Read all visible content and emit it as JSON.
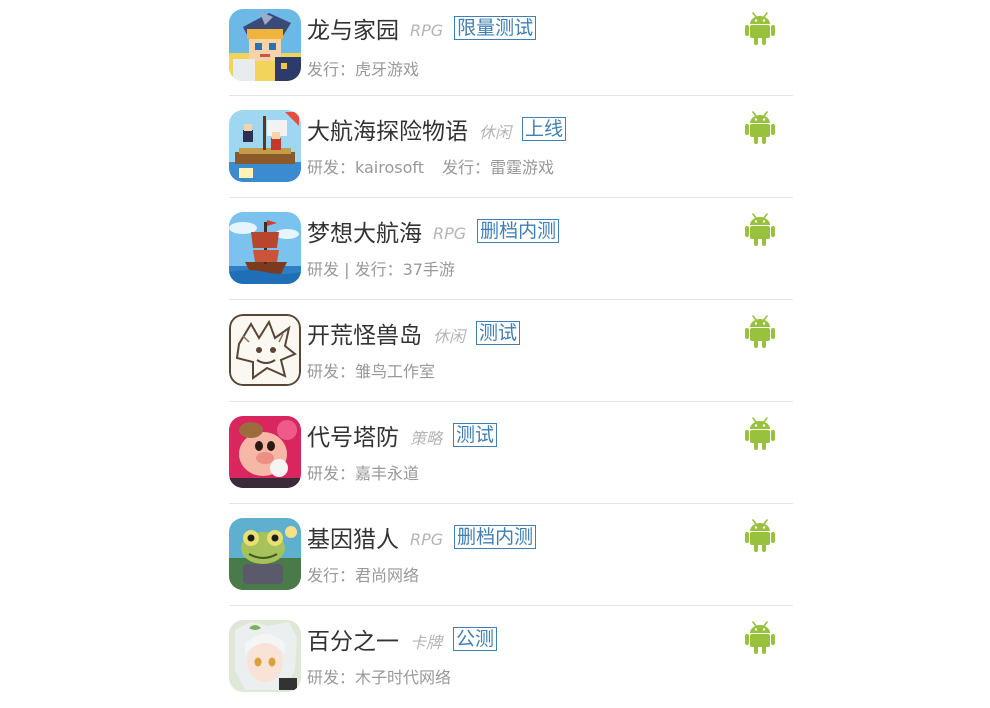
{
  "colors": {
    "android_green": "#98c13d",
    "tag_blue": "#3f7fb5",
    "title_text": "#333333",
    "meta_text": "#999999",
    "genre_text": "#b5b5b5",
    "divider": "#e5e5e5"
  },
  "games": [
    {
      "name": "龙与家园",
      "genre": "RPG",
      "status": "限量测试",
      "credits": [
        {
          "text": "发行：虎牙游戏"
        }
      ],
      "icon": "dragon-homeland-icon",
      "platform_icon": "android-icon"
    },
    {
      "name": "大航海探险物语",
      "genre": "休闲",
      "status": "上线",
      "credits": [
        {
          "text": "研发：kairosoft"
        },
        {
          "text": "发行：雷霆游戏"
        }
      ],
      "icon": "pirate-ship-pixel-icon",
      "platform_icon": "android-icon"
    },
    {
      "name": "梦想大航海",
      "genre": "RPG",
      "status": "删档内测",
      "credits": [
        {
          "text": "研发 | 发行：37手游"
        }
      ],
      "icon": "sailing-ship-icon",
      "platform_icon": "android-icon"
    },
    {
      "name": "开荒怪兽岛",
      "genre": "休闲",
      "status": "测试",
      "credits": [
        {
          "text": "研发：雏鸟工作室"
        }
      ],
      "icon": "monster-sketch-icon",
      "platform_icon": "android-icon"
    },
    {
      "name": "代号塔防",
      "genre": "策略",
      "status": "测试",
      "credits": [
        {
          "text": "研发：嘉丰永道"
        }
      ],
      "icon": "pig-character-icon",
      "platform_icon": "android-icon"
    },
    {
      "name": "基因猎人",
      "genre": "RPG",
      "status": "删档内测",
      "credits": [
        {
          "text": "发行：君尚网络"
        }
      ],
      "icon": "frog-warrior-icon",
      "platform_icon": "android-icon"
    },
    {
      "name": "百分之一",
      "genre": "卡牌",
      "status": "公测",
      "credits": [
        {
          "text": "研发：木子时代网络"
        }
      ],
      "icon": "anime-girl-icon",
      "platform_icon": "android-icon"
    }
  ]
}
